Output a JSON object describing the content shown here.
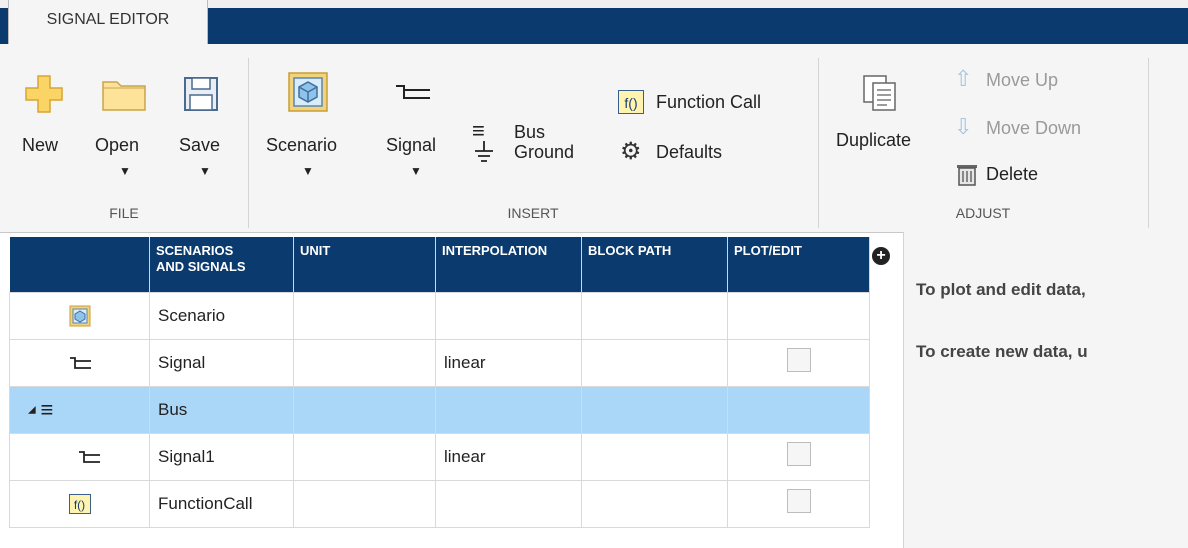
{
  "tabs": {
    "active": "SIGNAL EDITOR"
  },
  "ribbon": {
    "file": {
      "group_label": "FILE",
      "new": "New",
      "open": "Open",
      "save": "Save"
    },
    "insert": {
      "group_label": "INSERT",
      "scenario": "Scenario",
      "signal": "Signal",
      "bus": "Bus",
      "ground": "Ground",
      "function_call": "Function Call",
      "defaults": "Defaults"
    },
    "adjust": {
      "group_label": "ADJUST",
      "duplicate": "Duplicate",
      "move_up": "Move Up",
      "move_down": "Move Down",
      "delete": "Delete"
    }
  },
  "table": {
    "headers": [
      "",
      "SCENARIOS\nAND SIGNALS",
      "UNIT",
      "INTERPOLATION",
      "BLOCK PATH",
      "PLOT/EDIT"
    ],
    "rows": [
      {
        "name": "Scenario",
        "unit": "",
        "interpolation": "",
        "block_path": ""
      },
      {
        "name": "Signal",
        "unit": "",
        "interpolation": "linear",
        "block_path": ""
      },
      {
        "name": "Bus",
        "unit": "",
        "interpolation": "",
        "block_path": ""
      },
      {
        "name": "Signal1",
        "unit": "",
        "interpolation": "linear",
        "block_path": ""
      },
      {
        "name": "FunctionCall",
        "unit": "",
        "interpolation": "",
        "block_path": ""
      }
    ]
  },
  "right_pane": {
    "line1": "To plot and edit data,",
    "line2": "To create new data, u"
  },
  "colors": {
    "header_bg": "#0b3a6e",
    "selected_row": "#aad7f7",
    "ribbon_bg": "#f5f5f5"
  }
}
